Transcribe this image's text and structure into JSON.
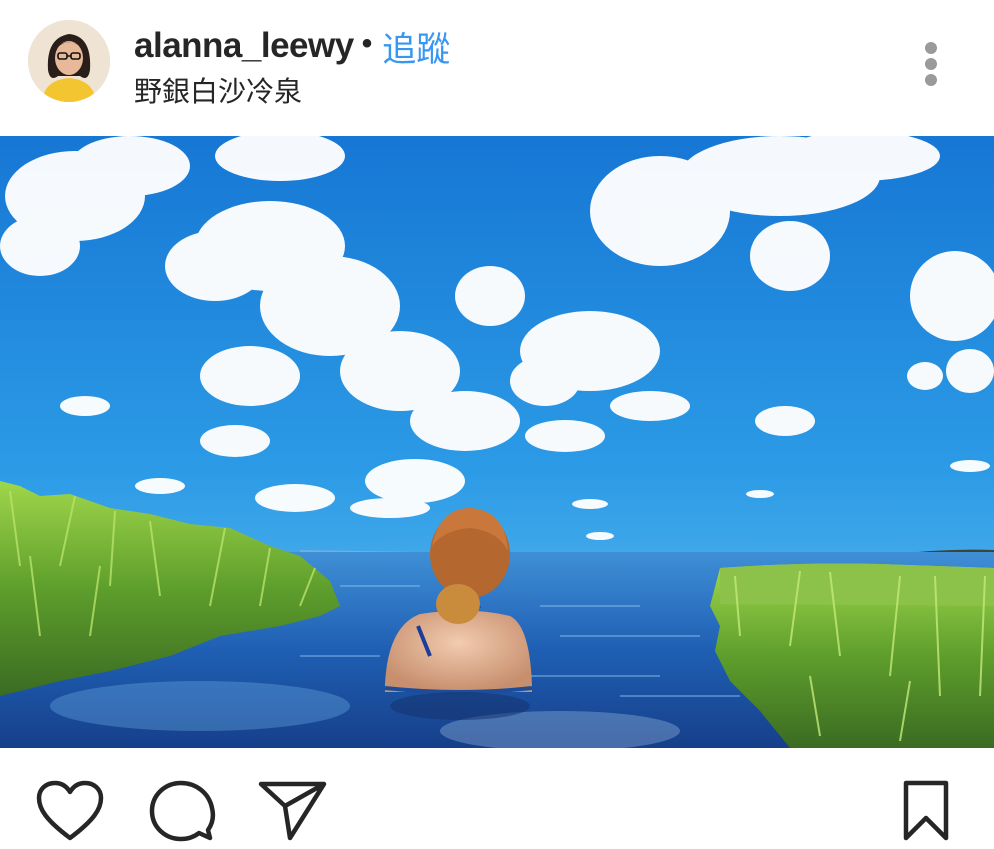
{
  "post": {
    "username": "alanna_leewy",
    "separator": "•",
    "follow_label": "追蹤",
    "location": "野銀白沙冷泉",
    "more_icon": "more-vertical-icon"
  },
  "actions": {
    "like_icon": "heart-icon",
    "comment_icon": "comment-bubble-icon",
    "share_icon": "paper-plane-icon",
    "save_icon": "bookmark-icon"
  },
  "colors": {
    "follow_link": "#3897f0",
    "text": "#262626",
    "icon_gray": "#9a9a9a"
  }
}
